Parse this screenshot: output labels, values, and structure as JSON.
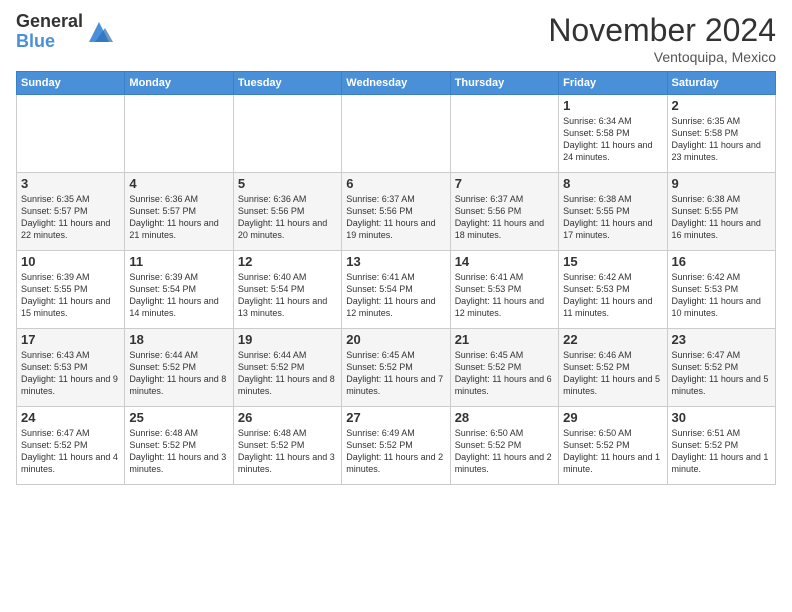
{
  "header": {
    "logo_general": "General",
    "logo_blue": "Blue",
    "month_title": "November 2024",
    "location": "Ventoquipa, Mexico"
  },
  "days_of_week": [
    "Sunday",
    "Monday",
    "Tuesday",
    "Wednesday",
    "Thursday",
    "Friday",
    "Saturday"
  ],
  "weeks": [
    [
      {
        "day": "",
        "info": ""
      },
      {
        "day": "",
        "info": ""
      },
      {
        "day": "",
        "info": ""
      },
      {
        "day": "",
        "info": ""
      },
      {
        "day": "",
        "info": ""
      },
      {
        "day": "1",
        "info": "Sunrise: 6:34 AM\nSunset: 5:58 PM\nDaylight: 11 hours and 24 minutes."
      },
      {
        "day": "2",
        "info": "Sunrise: 6:35 AM\nSunset: 5:58 PM\nDaylight: 11 hours and 23 minutes."
      }
    ],
    [
      {
        "day": "3",
        "info": "Sunrise: 6:35 AM\nSunset: 5:57 PM\nDaylight: 11 hours and 22 minutes."
      },
      {
        "day": "4",
        "info": "Sunrise: 6:36 AM\nSunset: 5:57 PM\nDaylight: 11 hours and 21 minutes."
      },
      {
        "day": "5",
        "info": "Sunrise: 6:36 AM\nSunset: 5:56 PM\nDaylight: 11 hours and 20 minutes."
      },
      {
        "day": "6",
        "info": "Sunrise: 6:37 AM\nSunset: 5:56 PM\nDaylight: 11 hours and 19 minutes."
      },
      {
        "day": "7",
        "info": "Sunrise: 6:37 AM\nSunset: 5:56 PM\nDaylight: 11 hours and 18 minutes."
      },
      {
        "day": "8",
        "info": "Sunrise: 6:38 AM\nSunset: 5:55 PM\nDaylight: 11 hours and 17 minutes."
      },
      {
        "day": "9",
        "info": "Sunrise: 6:38 AM\nSunset: 5:55 PM\nDaylight: 11 hours and 16 minutes."
      }
    ],
    [
      {
        "day": "10",
        "info": "Sunrise: 6:39 AM\nSunset: 5:55 PM\nDaylight: 11 hours and 15 minutes."
      },
      {
        "day": "11",
        "info": "Sunrise: 6:39 AM\nSunset: 5:54 PM\nDaylight: 11 hours and 14 minutes."
      },
      {
        "day": "12",
        "info": "Sunrise: 6:40 AM\nSunset: 5:54 PM\nDaylight: 11 hours and 13 minutes."
      },
      {
        "day": "13",
        "info": "Sunrise: 6:41 AM\nSunset: 5:54 PM\nDaylight: 11 hours and 12 minutes."
      },
      {
        "day": "14",
        "info": "Sunrise: 6:41 AM\nSunset: 5:53 PM\nDaylight: 11 hours and 12 minutes."
      },
      {
        "day": "15",
        "info": "Sunrise: 6:42 AM\nSunset: 5:53 PM\nDaylight: 11 hours and 11 minutes."
      },
      {
        "day": "16",
        "info": "Sunrise: 6:42 AM\nSunset: 5:53 PM\nDaylight: 11 hours and 10 minutes."
      }
    ],
    [
      {
        "day": "17",
        "info": "Sunrise: 6:43 AM\nSunset: 5:53 PM\nDaylight: 11 hours and 9 minutes."
      },
      {
        "day": "18",
        "info": "Sunrise: 6:44 AM\nSunset: 5:52 PM\nDaylight: 11 hours and 8 minutes."
      },
      {
        "day": "19",
        "info": "Sunrise: 6:44 AM\nSunset: 5:52 PM\nDaylight: 11 hours and 8 minutes."
      },
      {
        "day": "20",
        "info": "Sunrise: 6:45 AM\nSunset: 5:52 PM\nDaylight: 11 hours and 7 minutes."
      },
      {
        "day": "21",
        "info": "Sunrise: 6:45 AM\nSunset: 5:52 PM\nDaylight: 11 hours and 6 minutes."
      },
      {
        "day": "22",
        "info": "Sunrise: 6:46 AM\nSunset: 5:52 PM\nDaylight: 11 hours and 5 minutes."
      },
      {
        "day": "23",
        "info": "Sunrise: 6:47 AM\nSunset: 5:52 PM\nDaylight: 11 hours and 5 minutes."
      }
    ],
    [
      {
        "day": "24",
        "info": "Sunrise: 6:47 AM\nSunset: 5:52 PM\nDaylight: 11 hours and 4 minutes."
      },
      {
        "day": "25",
        "info": "Sunrise: 6:48 AM\nSunset: 5:52 PM\nDaylight: 11 hours and 3 minutes."
      },
      {
        "day": "26",
        "info": "Sunrise: 6:48 AM\nSunset: 5:52 PM\nDaylight: 11 hours and 3 minutes."
      },
      {
        "day": "27",
        "info": "Sunrise: 6:49 AM\nSunset: 5:52 PM\nDaylight: 11 hours and 2 minutes."
      },
      {
        "day": "28",
        "info": "Sunrise: 6:50 AM\nSunset: 5:52 PM\nDaylight: 11 hours and 2 minutes."
      },
      {
        "day": "29",
        "info": "Sunrise: 6:50 AM\nSunset: 5:52 PM\nDaylight: 11 hours and 1 minute."
      },
      {
        "day": "30",
        "info": "Sunrise: 6:51 AM\nSunset: 5:52 PM\nDaylight: 11 hours and 1 minute."
      }
    ]
  ]
}
